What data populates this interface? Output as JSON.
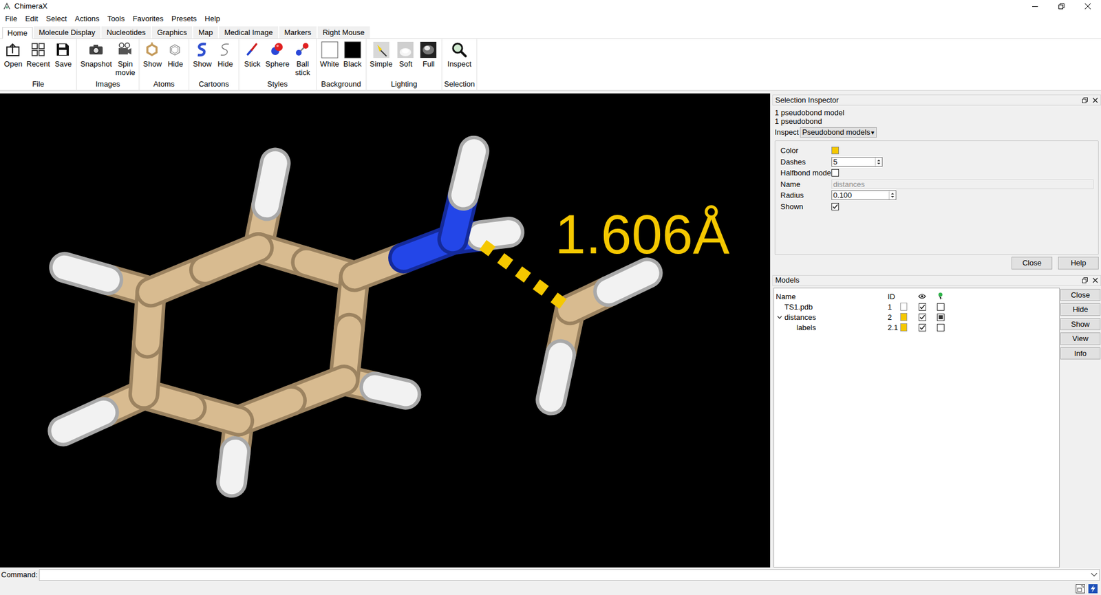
{
  "window": {
    "title": "ChimeraX"
  },
  "menu": [
    "File",
    "Edit",
    "Select",
    "Actions",
    "Tools",
    "Favorites",
    "Presets",
    "Help"
  ],
  "ribbon_tabs": [
    {
      "label": "Home",
      "selected": true
    },
    {
      "label": "Molecule Display",
      "selected": false
    },
    {
      "label": "Nucleotides",
      "selected": false
    },
    {
      "label": "Graphics",
      "selected": false
    },
    {
      "label": "Map",
      "selected": false
    },
    {
      "label": "Medical Image",
      "selected": false
    },
    {
      "label": "Markers",
      "selected": false
    },
    {
      "label": "Right Mouse",
      "selected": false
    }
  ],
  "toolbar": [
    {
      "label": "File",
      "buttons": [
        {
          "label": "Open"
        },
        {
          "label": "Recent"
        },
        {
          "label": "Save"
        }
      ]
    },
    {
      "label": "Images",
      "buttons": [
        {
          "label": "Snapshot"
        },
        {
          "label": "Spin movie"
        }
      ]
    },
    {
      "label": "Atoms",
      "buttons": [
        {
          "label": "Show"
        },
        {
          "label": "Hide"
        }
      ]
    },
    {
      "label": "Cartoons",
      "buttons": [
        {
          "label": "Show"
        },
        {
          "label": "Hide"
        }
      ]
    },
    {
      "label": "Styles",
      "buttons": [
        {
          "label": "Stick"
        },
        {
          "label": "Sphere"
        },
        {
          "label": "Ball stick"
        }
      ]
    },
    {
      "label": "Background",
      "buttons": [
        {
          "label": "White",
          "color": "#ffffff"
        },
        {
          "label": "Black",
          "color": "#000000"
        }
      ]
    },
    {
      "label": "Lighting",
      "buttons": [
        {
          "label": "Simple"
        },
        {
          "label": "Soft"
        },
        {
          "label": "Full"
        }
      ]
    },
    {
      "label": "Selection",
      "buttons": [
        {
          "label": "Inspect"
        }
      ]
    }
  ],
  "graphics": {
    "distance_label": "1.606Å"
  },
  "inspector": {
    "title": "Selection Inspector",
    "summary": [
      "1 pseudobond model",
      "1 pseudobond"
    ],
    "inspect_label": "Inspect",
    "inspect_value": "Pseudobond models",
    "inspect_arrow": "▾",
    "fields": [
      {
        "label": "Color",
        "kind": "color",
        "color": "#f5c800"
      },
      {
        "label": "Dashes",
        "kind": "spin",
        "value": "5"
      },
      {
        "label": "Halfbond mode",
        "kind": "checkbox",
        "checked": false
      },
      {
        "label": "Name",
        "kind": "text",
        "value": "distances",
        "disabled": true
      },
      {
        "label": "Radius",
        "kind": "spin",
        "value": "0.100"
      },
      {
        "label": "Shown",
        "kind": "checkbox",
        "checked": true
      }
    ],
    "buttons": [
      "Close",
      "Help"
    ]
  },
  "models": {
    "title": "Models",
    "columns": [
      "Name",
      "ID"
    ],
    "rows": [
      {
        "name": "TS1.pdb",
        "id": "1",
        "depth": 0,
        "has_children": false,
        "expanded": false,
        "color": "#ffffff",
        "shown": true,
        "select": "none"
      },
      {
        "name": "distances",
        "id": "2",
        "depth": 0,
        "has_children": true,
        "expanded": true,
        "color": "#f5c800",
        "shown": true,
        "select": "partial"
      },
      {
        "name": "labels",
        "id": "2.1",
        "depth": 1,
        "has_children": false,
        "expanded": false,
        "color": "#f5c800",
        "shown": true,
        "select": "none"
      }
    ],
    "buttons": [
      "Close",
      "Hide",
      "Show",
      "View",
      "Info"
    ]
  },
  "command": {
    "label": "Command:",
    "value": ""
  }
}
